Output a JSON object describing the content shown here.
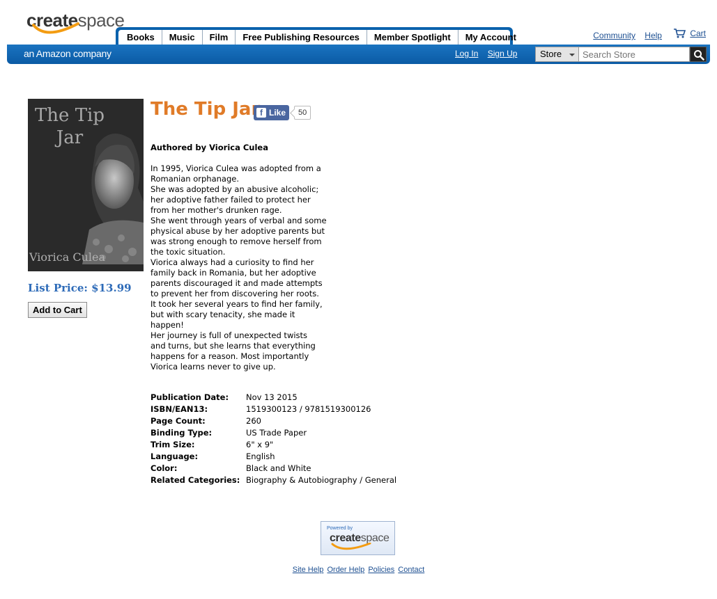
{
  "header": {
    "logo_part1": "create",
    "logo_part2": "space",
    "tagline": "an Amazon company",
    "tabs": [
      "Books",
      "Music",
      "Film",
      "Free Publishing Resources",
      "Member Spotlight",
      "My Account"
    ],
    "top_links": {
      "community": "Community",
      "help": "Help",
      "cart": "Cart"
    },
    "auth": {
      "login": "Log In",
      "signup": "Sign Up"
    },
    "search": {
      "store_option": "Store",
      "placeholder": "Search Store"
    }
  },
  "book": {
    "title": "The Tip Jar",
    "cover_title": "The Tip Jar",
    "cover_author": "Viorica Culea",
    "facebook": {
      "label": "Like",
      "count": "50"
    },
    "author_line": "Authored by Viorica Culea",
    "description_lines": [
      "In 1995, Viorica Culea was adopted from a",
      "Romanian orphanage.",
      "She was adopted by an abusive alcoholic;",
      "her adoptive father failed to protect her",
      "from her mother's drunken rage.",
      "She went through years of verbal and some",
      "physical abuse by her adoptive parents but",
      "was strong enough to remove herself from",
      "the toxic situation.",
      "Viorica always had a curiosity to find her",
      "family back in Romania, but her adoptive",
      "parents discouraged it and made attempts",
      "to prevent her from discovering her roots.",
      "It took her several years to find her family,",
      "but with scary tenacity, she made it",
      "happen!",
      "Her journey is full of unexpected twists",
      "and turns, but she learns that everything",
      "happens for a reason. Most importantly",
      "Viorica learns never to give up."
    ],
    "list_price": "List Price: $13.99",
    "add_to_cart": "Add to Cart",
    "details": [
      {
        "label": "Publication Date:",
        "value": "Nov 13 2015"
      },
      {
        "label": "ISBN/EAN13:",
        "value": "1519300123 / 9781519300126"
      },
      {
        "label": "Page Count:",
        "value": "260"
      },
      {
        "label": "Binding Type:",
        "value": "US Trade Paper"
      },
      {
        "label": "Trim Size:",
        "value": "6\" x 9\""
      },
      {
        "label": "Language:",
        "value": "English"
      },
      {
        "label": "Color:",
        "value": "Black and White"
      },
      {
        "label": "Related Categories:",
        "value": "Biography & Autobiography / General"
      }
    ]
  },
  "footer": {
    "powered_by": "Powered by",
    "powered_part1": "create",
    "powered_part2": "space",
    "links": [
      "Site Help",
      "Order Help",
      "Policies",
      "Contact"
    ]
  },
  "colors": {
    "brand_blue": "#0b62ad",
    "title_orange": "#e07b28",
    "price_blue": "#2e6bb8",
    "link_blue": "#1d4f91",
    "logo_swoosh": "#f39c12"
  }
}
